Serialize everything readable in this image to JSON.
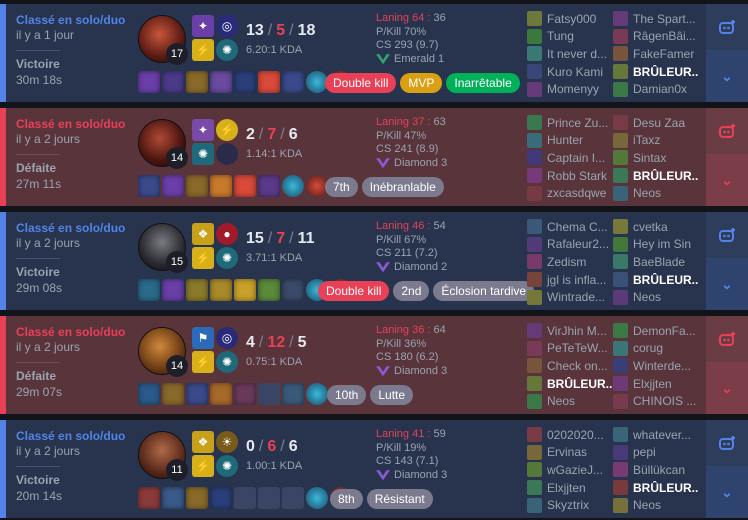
{
  "colors": {
    "win": "#5383e8",
    "loss": "#e84057",
    "mvp": "#d8a012",
    "unstoppable": "#00b159"
  },
  "matches": [
    {
      "result_class": "win",
      "queue": "Classé en solo/duo",
      "when": "il y a 1 jour",
      "result": "Victoire",
      "duration": "30m 18s",
      "champion_level": "17",
      "kills": "13",
      "deaths": "5",
      "assists": "18",
      "kda_ratio": "6.20:1 KDA",
      "lane_label": "Laning 64",
      "lane_score": "36",
      "pkill": "P/Kill 70%",
      "cs": "CS 293 (9.7)",
      "rank": "Emerald 1",
      "rank_color": "#2fa36b",
      "badges": [
        {
          "label": "Double kill",
          "kind": "b-red"
        },
        {
          "label": "MVP",
          "kind": "b-gold"
        },
        {
          "label": "Inarrêtable",
          "kind": "b-green"
        }
      ],
      "items": [
        "#6a3fa8",
        "#4a3a8a",
        "#8a6a2a",
        "#6b4aa0",
        "#2a3f7a",
        "#d84a3a",
        "#3a4a8a"
      ],
      "team1": [
        {
          "name": "Fatsy000",
          "me": false
        },
        {
          "name": "Tung",
          "me": false
        },
        {
          "name": "It never d...",
          "me": false
        },
        {
          "name": "Kuro Kami",
          "me": false
        },
        {
          "name": "Momenyy",
          "me": false
        }
      ],
      "team2": [
        {
          "name": "The Spart...",
          "me": false
        },
        {
          "name": "RâgenBâi...",
          "me": false
        },
        {
          "name": "FakeFamer",
          "me": false
        },
        {
          "name": "BRÛLEUR...",
          "me": true
        },
        {
          "name": "Damian0x",
          "me": false
        }
      ]
    },
    {
      "result_class": "loss",
      "queue": "Classé en solo/duo",
      "when": "il y a 2 jours",
      "result": "Défaite",
      "duration": "27m 11s",
      "champion_level": "14",
      "kills": "2",
      "deaths": "7",
      "assists": "6",
      "kda_ratio": "1.14:1 KDA",
      "lane_label": "Laning 37",
      "lane_score": "63",
      "pkill": "P/Kill 47%",
      "cs": "CS 241 (8.9)",
      "rank": "Diamond 3",
      "rank_color": "#8a5ad6",
      "badges": [
        {
          "label": "7th",
          "kind": "b-gray"
        },
        {
          "label": "Inébranlable",
          "kind": "b-gray"
        }
      ],
      "items": [
        "#3a4a8a",
        "#6a3fa8",
        "#8a6a2a",
        "#c87a2a",
        "#d84a3a",
        "#5a3a8a"
      ],
      "team1": [
        {
          "name": "Prince Zu...",
          "me": false
        },
        {
          "name": "Hunter",
          "me": false
        },
        {
          "name": "Captain I...",
          "me": false
        },
        {
          "name": "Robb Stark",
          "me": false
        },
        {
          "name": "zxcasdqwe",
          "me": false
        }
      ],
      "team2": [
        {
          "name": "Desu Zaa",
          "me": false
        },
        {
          "name": "iTaxz",
          "me": false
        },
        {
          "name": "Sintax",
          "me": false
        },
        {
          "name": "BRÛLEUR...",
          "me": true
        },
        {
          "name": "Neos",
          "me": false
        }
      ]
    },
    {
      "result_class": "win",
      "queue": "Classé en solo/duo",
      "when": "il y a 2 jours",
      "result": "Victoire",
      "duration": "29m 08s",
      "champion_level": "15",
      "kills": "15",
      "deaths": "7",
      "assists": "11",
      "kda_ratio": "3.71:1 KDA",
      "lane_label": "Laning 46",
      "lane_score": "54",
      "pkill": "P/Kill 67%",
      "cs": "CS 211 (7.2)",
      "rank": "Diamond 2",
      "rank_color": "#8a5ad6",
      "badges": [
        {
          "label": "Double kill",
          "kind": "b-red"
        },
        {
          "label": "2nd",
          "kind": "b-gray"
        },
        {
          "label": "Éclosion tardive",
          "kind": "b-gray"
        }
      ],
      "items": [
        "#2a6a8a",
        "#6a3fa8",
        "#8a7a2a",
        "#a88a2a",
        "#c8a02a",
        "#5a8a3a",
        "#3a4a6a"
      ],
      "team1": [
        {
          "name": "Chema C...",
          "me": false
        },
        {
          "name": "Rafaleur2...",
          "me": false
        },
        {
          "name": "Zedism",
          "me": false
        },
        {
          "name": "jgl is infla...",
          "me": false
        },
        {
          "name": "Wintrade...",
          "me": false
        }
      ],
      "team2": [
        {
          "name": "cvetka",
          "me": false
        },
        {
          "name": "Hey im Sin",
          "me": false
        },
        {
          "name": "BaeBlade",
          "me": false
        },
        {
          "name": "BRÛLEUR...",
          "me": true
        },
        {
          "name": "Neos",
          "me": false
        }
      ]
    },
    {
      "result_class": "loss",
      "queue": "Classé en solo/duo",
      "when": "il y a 2 jours",
      "result": "Défaite",
      "duration": "29m 07s",
      "champion_level": "14",
      "kills": "4",
      "deaths": "12",
      "assists": "5",
      "kda_ratio": "0.75:1 KDA",
      "lane_label": "Laning 36",
      "lane_score": "64",
      "pkill": "P/Kill 36%",
      "cs": "CS 180 (6.2)",
      "rank": "Diamond 3",
      "rank_color": "#8a5ad6",
      "badges": [
        {
          "label": "10th",
          "kind": "b-gray"
        },
        {
          "label": "Lutte",
          "kind": "b-gray"
        }
      ],
      "items": [
        "#2a5a8a",
        "#8a6a2a",
        "#3a4a8a",
        "#a86a2a",
        "#6a3a5a",
        "",
        "#3a5a7a"
      ],
      "team1": [
        {
          "name": "VirJhin M...",
          "me": false
        },
        {
          "name": "PeTeTeW...",
          "me": false
        },
        {
          "name": "Check on...",
          "me": false
        },
        {
          "name": "BRÛLEUR...",
          "me": true
        },
        {
          "name": "Neos",
          "me": false
        }
      ],
      "team2": [
        {
          "name": "DemonFa...",
          "me": false
        },
        {
          "name": "corug",
          "me": false
        },
        {
          "name": "Winterde...",
          "me": false
        },
        {
          "name": "Elxjjten",
          "me": false
        },
        {
          "name": "CHINOIS ...",
          "me": false
        }
      ]
    },
    {
      "result_class": "win",
      "queue": "Classé en solo/duo",
      "when": "il y a 2 jours",
      "result": "Victoire",
      "duration": "20m 14s",
      "champion_level": "11",
      "kills": "0",
      "deaths": "6",
      "assists": "6",
      "kda_ratio": "1.00:1 KDA",
      "lane_label": "Laning 41",
      "lane_score": "59",
      "pkill": "P/Kill 19%",
      "cs": "CS 143 (7.1)",
      "rank": "Diamond 3",
      "rank_color": "#8a5ad6",
      "badges": [
        {
          "label": "8th",
          "kind": "b-gray"
        },
        {
          "label": "Résistant",
          "kind": "b-gray"
        }
      ],
      "items": [
        "#8a3a3a",
        "#3a5a8a",
        "#8a6a2a",
        "#2a3f7a",
        "",
        "",
        ""
      ],
      "team1": [
        {
          "name": "0202020...",
          "me": false
        },
        {
          "name": "Ervinas",
          "me": false
        },
        {
          "name": "wGazieJ...",
          "me": false
        },
        {
          "name": "Elxjjten",
          "me": false
        },
        {
          "name": "Skyztrix",
          "me": false
        }
      ],
      "team2": [
        {
          "name": "whatever...",
          "me": false
        },
        {
          "name": "pepi",
          "me": false
        },
        {
          "name": "Büllükcan",
          "me": false
        },
        {
          "name": "BRÛLEUR...",
          "me": true
        },
        {
          "name": "Neos",
          "me": false
        }
      ]
    }
  ]
}
